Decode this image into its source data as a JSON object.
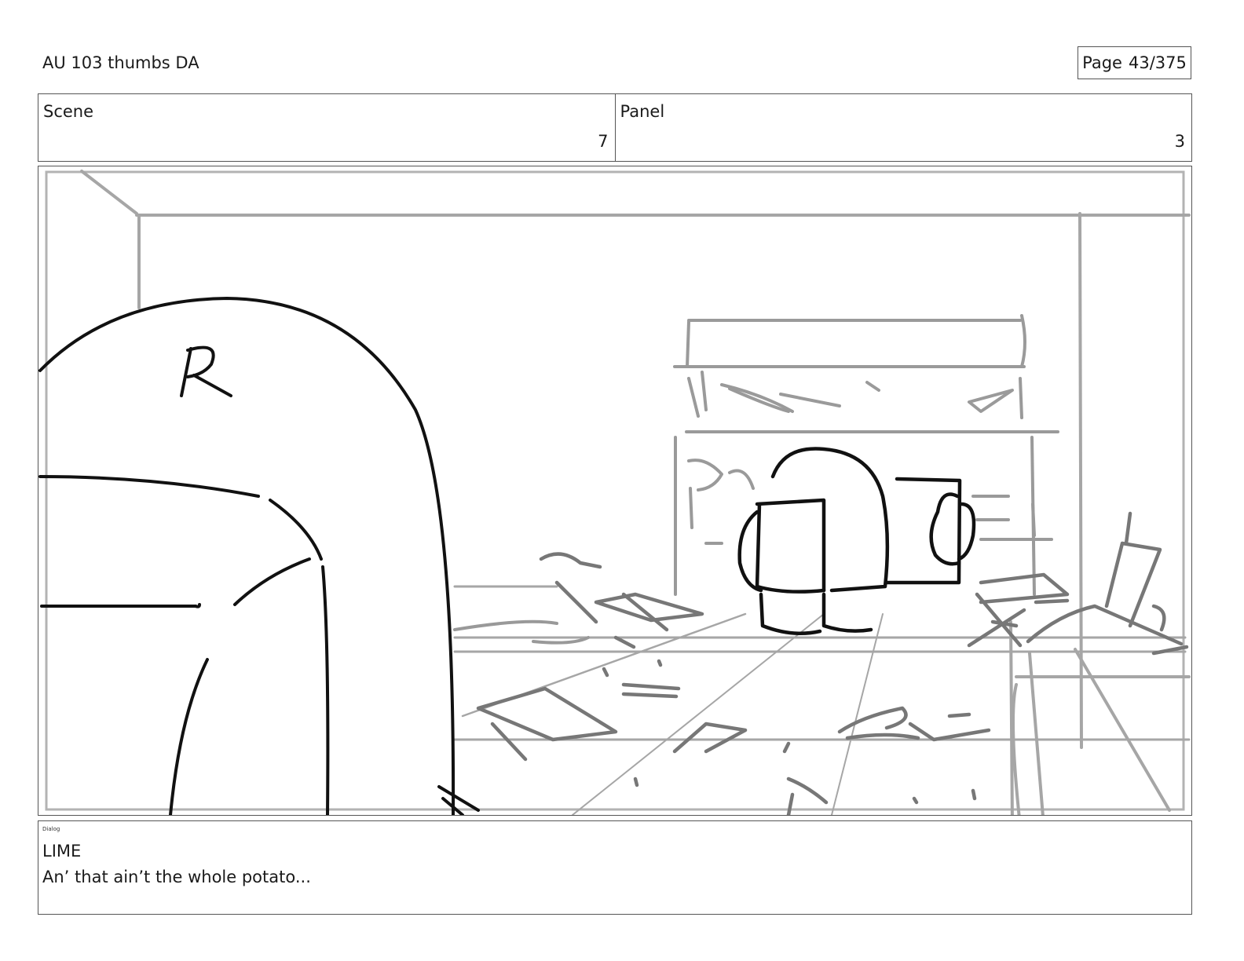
{
  "header": {
    "title": "AU 103 thumbs DA",
    "page_label": "Page",
    "page_number": "43/375"
  },
  "meta": {
    "scene_label": "Scene",
    "scene_value": "7",
    "panel_label": "Panel",
    "panel_value": "3"
  },
  "frame": {
    "sketch_letter": "R"
  },
  "dialog": {
    "label": "Dialog",
    "character": "LIME",
    "line": "An’ that ain’t the whole potato..."
  }
}
